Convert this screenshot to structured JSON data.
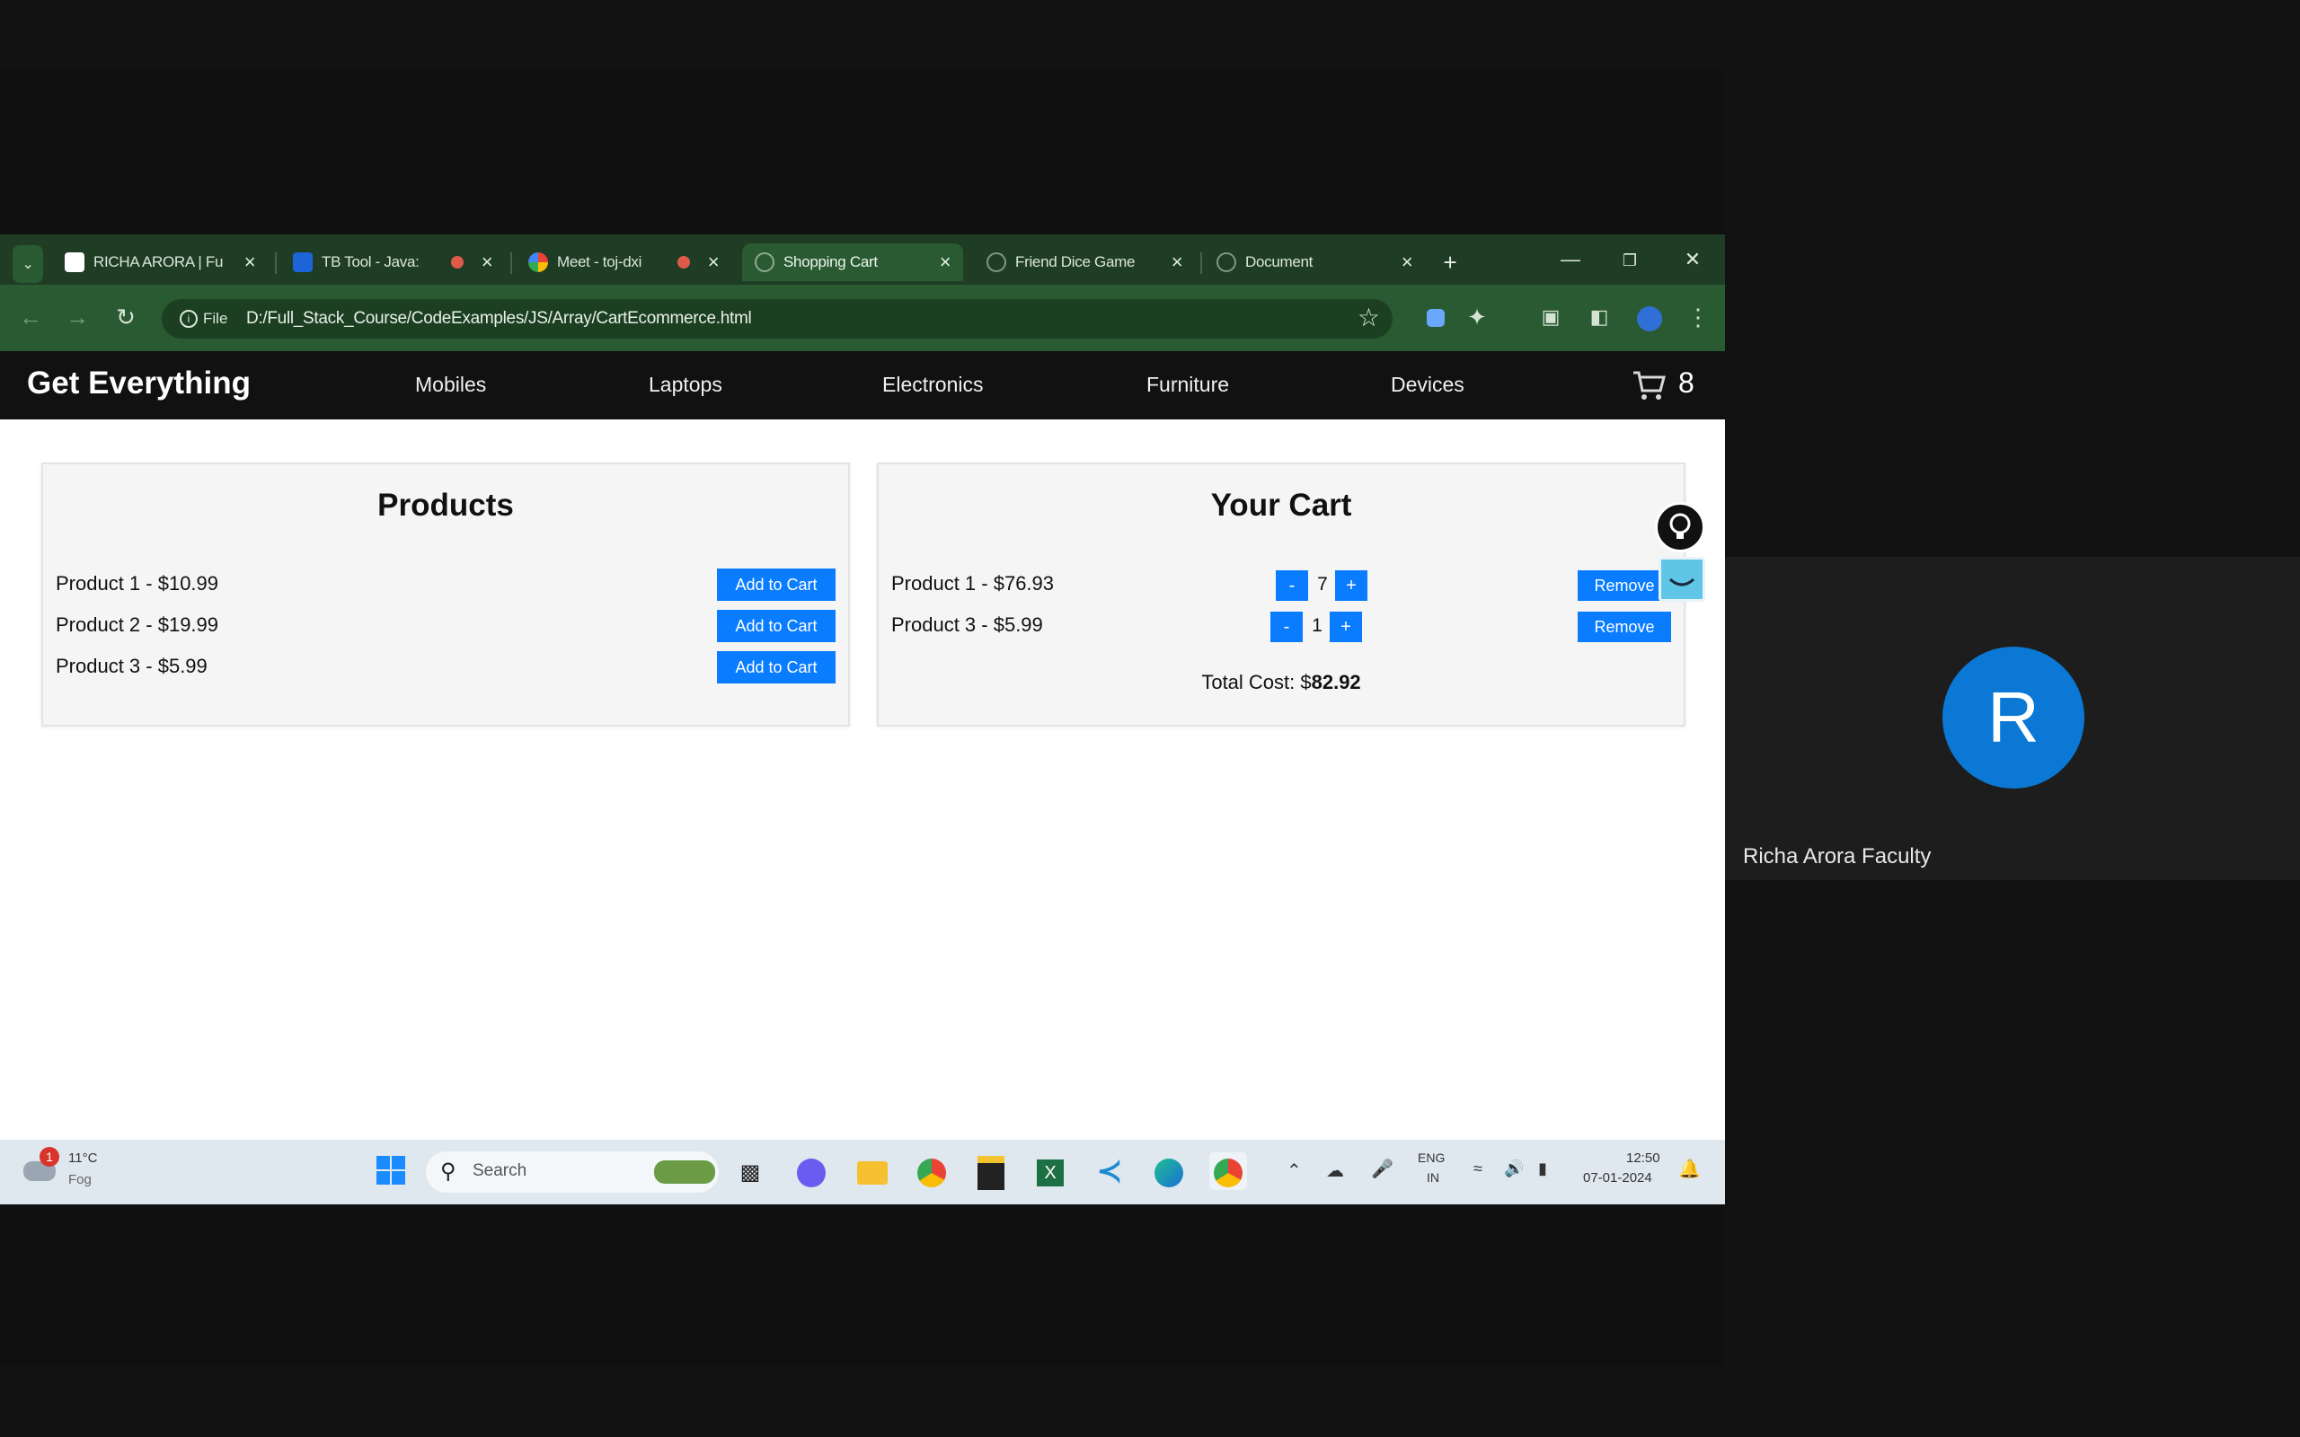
{
  "browser": {
    "tabs": [
      {
        "title": "RICHA ARORA | Fu",
        "active": false,
        "recording": false
      },
      {
        "title": "TB Tool - Java:",
        "active": false,
        "recording": true
      },
      {
        "title": "Meet - toj-dxi",
        "active": false,
        "recording": true
      },
      {
        "title": "Shopping Cart",
        "active": true,
        "recording": false
      },
      {
        "title": "Friend Dice Game",
        "active": false,
        "recording": false
      },
      {
        "title": "Document",
        "active": false,
        "recording": false
      }
    ],
    "url_chip": "File",
    "url": "D:/Full_Stack_Course/CodeExamples/JS/Array/CartEcommerce.html"
  },
  "site": {
    "brand": "Get Everything",
    "nav": [
      "Mobiles",
      "Laptops",
      "Electronics",
      "Furniture",
      "Devices"
    ],
    "cart_count": "8"
  },
  "products": {
    "heading": "Products",
    "items": [
      {
        "label": "Product 1 - $10.99",
        "button": "Add to Cart"
      },
      {
        "label": "Product 2 - $19.99",
        "button": "Add to Cart"
      },
      {
        "label": "Product 3 - $5.99",
        "button": "Add to Cart"
      }
    ]
  },
  "cart": {
    "heading": "Your Cart",
    "items": [
      {
        "label": "Product 1 - $76.93",
        "minus": "-",
        "qty": "7",
        "plus": "+",
        "remove": "Remove"
      },
      {
        "label": "Product 3 - $5.99",
        "minus": "-",
        "qty": "1",
        "plus": "+",
        "remove": "Remove"
      }
    ],
    "total_label": "Total Cost: $",
    "total_value": "82.92"
  },
  "taskbar": {
    "weather_temp": "11°C",
    "weather_desc": "Fog",
    "weather_badge": "1",
    "search_placeholder": "Search",
    "lang_top": "ENG",
    "lang_bottom": "IN",
    "time": "12:50",
    "date": "07-01-2024"
  },
  "participant": {
    "initial": "R",
    "name": "Richa Arora Faculty"
  },
  "colors": {
    "browser_frame": "#1f3d24",
    "accent_button": "#0a7cff",
    "avatar": "#0a78d4"
  }
}
